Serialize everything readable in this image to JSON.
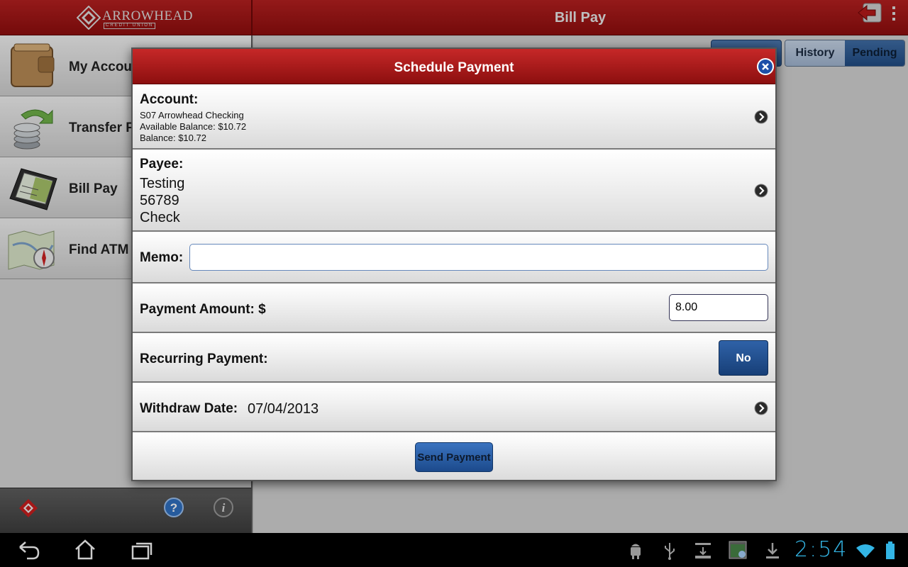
{
  "app": {
    "logo_text": "ARROWHEAD",
    "logo_subtext": "CREDIT UNION",
    "page_title": "Bill Pay"
  },
  "sidebar": {
    "items": [
      {
        "label": "My Accou",
        "icon": "wallet-icon"
      },
      {
        "label": "Transfer F",
        "icon": "transfer-coins-icon"
      },
      {
        "label": "Bill Pay",
        "icon": "checkbook-icon"
      },
      {
        "label": "Find ATM",
        "icon": "map-compass-icon"
      }
    ]
  },
  "segments": {
    "history": "History",
    "pending": "Pending"
  },
  "dialog": {
    "title": "Schedule Payment",
    "account_label": "Account:",
    "account_name": "S07 Arrowhead Checking",
    "available_balance": "Available Balance: $10.72",
    "balance": "Balance: $10.72",
    "payee_label": "Payee:",
    "payee_name": "Testing",
    "payee_number": "56789",
    "payee_method": "Check",
    "memo_label": "Memo:",
    "memo_value": "",
    "amount_label": "Payment Amount: $",
    "amount_value": "8.00",
    "recurring_label": "Recurring Payment:",
    "recurring_value": "No",
    "withdraw_label": "Withdraw Date:",
    "withdraw_date": "07/04/2013",
    "send_label": "Send Payment"
  },
  "system_bar": {
    "time": "2:54"
  },
  "colors": {
    "header_red": "#b52020",
    "button_blue": "#2f62a8",
    "clock_blue": "#33b5e5"
  }
}
